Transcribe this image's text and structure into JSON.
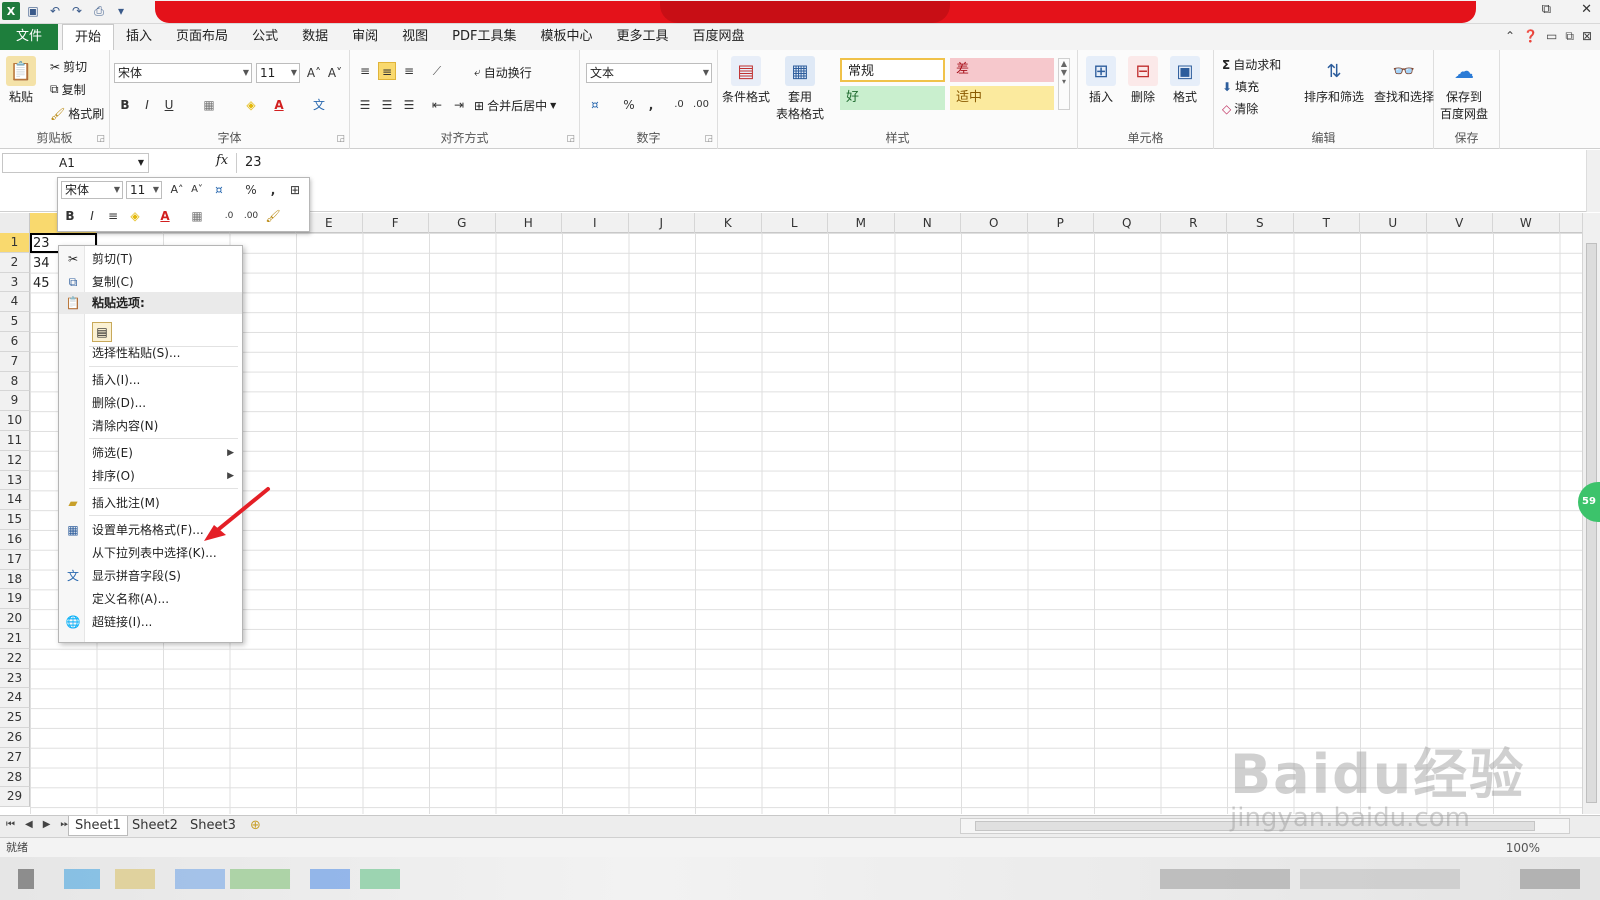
{
  "title_bar": {
    "controls": [
      "⧉",
      "✕"
    ]
  },
  "menu": {
    "tabs": [
      "文件",
      "开始",
      "插入",
      "页面布局",
      "公式",
      "数据",
      "审阅",
      "视图",
      "PDF工具集",
      "模板中心",
      "更多工具",
      "百度网盘"
    ],
    "active": "开始"
  },
  "ribbon": {
    "clipboard": {
      "label": "剪贴板",
      "paste": "粘贴",
      "cut": "剪切",
      "copy": "复制",
      "format_painter": "格式刷"
    },
    "font": {
      "label": "字体",
      "name": "宋体",
      "size": "11",
      "bold": "B",
      "italic": "I",
      "underline": "U",
      "grow": "A˄",
      "shrink": "A˅"
    },
    "alignment": {
      "label": "对齐方式",
      "wrap": "自动换行",
      "merge": "合并后居中"
    },
    "number": {
      "label": "数字",
      "format": "文本",
      "percent": "%",
      "comma": ","
    },
    "styles": {
      "label": "样式",
      "cond_format": "条件格式",
      "table_format": "套用\n表格格式",
      "normal": "常规",
      "bad": "差",
      "good": "好",
      "neutral": "适中"
    },
    "cells": {
      "label": "单元格",
      "insert": "插入",
      "delete": "删除",
      "format": "格式"
    },
    "editing": {
      "label": "编辑",
      "autosum": "自动求和",
      "fill": "填充",
      "clear": "清除",
      "sort": "排序和筛选",
      "find": "查找和选择"
    },
    "save": {
      "label": "保存",
      "save_to": "保存到\n百度网盘"
    }
  },
  "formula_bar": {
    "name_box": "A1",
    "fx": "fx",
    "value": "23"
  },
  "mini_toolbar": {
    "font": "宋体",
    "size": "11"
  },
  "grid": {
    "columns": [
      "E",
      "F",
      "G",
      "H",
      "I",
      "J",
      "K",
      "L",
      "M",
      "N",
      "O",
      "P",
      "Q",
      "R",
      "S",
      "T",
      "U",
      "V",
      "W"
    ],
    "rows": [
      "1",
      "2",
      "3",
      "4",
      "5",
      "6",
      "7",
      "8",
      "9",
      "10",
      "11",
      "12",
      "13",
      "14",
      "15",
      "16",
      "17",
      "18",
      "19",
      "20",
      "21",
      "22",
      "23",
      "24",
      "25",
      "26",
      "27",
      "28",
      "29"
    ],
    "values": [
      "23",
      "34",
      "45"
    ]
  },
  "context_menu": {
    "cut": "剪切(T)",
    "copy": "复制(C)",
    "paste_options": "粘贴选项:",
    "paste_special": "选择性粘贴(S)...",
    "insert": "插入(I)...",
    "delete": "删除(D)...",
    "clear": "清除内容(N)",
    "filter": "筛选(E)",
    "sort": "排序(O)",
    "insert_comment": "插入批注(M)",
    "format_cells": "设置单元格格式(F)...",
    "pick_list": "从下拉列表中选择(K)...",
    "phonetic": "显示拼音字段(S)",
    "define_name": "定义名称(A)...",
    "hyperlink": "超链接(I)..."
  },
  "sheets": {
    "tabs": [
      "Sheet1",
      "Sheet2",
      "Sheet3"
    ],
    "active": "Sheet1"
  },
  "status": {
    "mode": "就绪",
    "zoom": "100%"
  },
  "watermark": {
    "line1": "Baidu经验",
    "line2": "jingyan.baidu.com"
  },
  "badge": "59",
  "colors": {
    "file_tab": "#1e7e3c",
    "title_red": "#e4121a",
    "selection": "#f9d96e",
    "arrow": "#e41f26"
  }
}
